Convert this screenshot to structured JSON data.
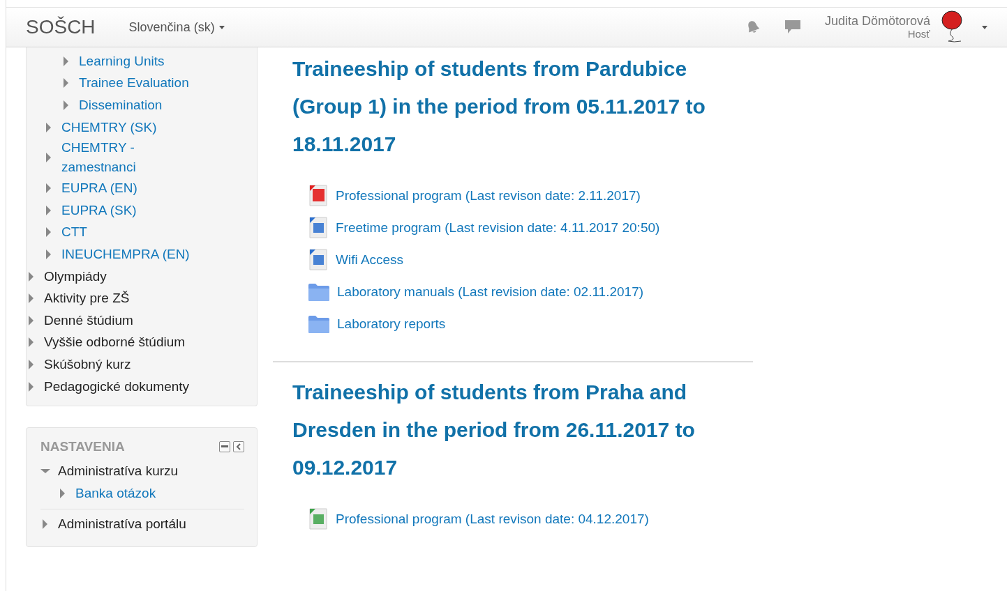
{
  "navbar": {
    "brand": "SOŠCH",
    "language": "Slovenčina (sk)",
    "user_name": "Judita Dömötorová",
    "user_role": "Hosť"
  },
  "navigation": {
    "items": [
      {
        "children": [
          {
            "children": [
              {
                "label": "Learning Units",
                "kind": "link",
                "expanded": false
              },
              {
                "label": "Trainee Evaluation",
                "kind": "link",
                "expanded": false
              },
              {
                "label": "Dissemination",
                "kind": "link",
                "expanded": false
              }
            ]
          },
          {
            "label": "CHEMTRY (SK)",
            "kind": "link",
            "expanded": false
          },
          {
            "label": "CHEMTRY - zamestnanci",
            "kind": "link",
            "expanded": false
          },
          {
            "label": "EUPRA (EN)",
            "kind": "link",
            "expanded": false
          },
          {
            "label": "EUPRA (SK)",
            "kind": "link",
            "expanded": false
          },
          {
            "label": "CTT",
            "kind": "link",
            "expanded": false
          },
          {
            "label": "INEUCHEMPRA (EN)",
            "kind": "link",
            "expanded": false
          }
        ]
      },
      {
        "label": "Olympiády",
        "kind": "category",
        "expanded": false
      },
      {
        "label": "Aktivity pre ZŠ",
        "kind": "category",
        "expanded": false
      },
      {
        "label": "Denné štúdium",
        "kind": "category",
        "expanded": false
      },
      {
        "label": "Vyššie odborné štúdium",
        "kind": "category",
        "expanded": false
      },
      {
        "label": "Skúšobný kurz",
        "kind": "category",
        "expanded": false
      },
      {
        "label": "Pedagogické dokumenty",
        "kind": "category",
        "expanded": false
      }
    ]
  },
  "settings": {
    "title": "NASTAVENIA",
    "items": [
      {
        "label": "Administratíva kurzu",
        "kind": "category",
        "expanded": true,
        "children": [
          {
            "label": "Banka otázok",
            "kind": "link",
            "expanded": false
          }
        ]
      },
      {
        "label": "Administratíva portálu",
        "kind": "category",
        "expanded": false
      }
    ]
  },
  "sections": [
    {
      "title": "Traineeship of students from Pardubice (Group 1) in the period from 05.11.2017 to 18.11.2017",
      "files": [
        {
          "kind": "pdf",
          "label": "Professional program (Last revison date: 2.11.2017)"
        },
        {
          "kind": "word",
          "label": "Freetime program (Last revision date: 4.11.2017 20:50)"
        },
        {
          "kind": "word",
          "label": "Wifi Access"
        },
        {
          "kind": "folder",
          "label": "Laboratory manuals (Last revision date: 02.11.2017)"
        },
        {
          "kind": "folder",
          "label": "Laboratory reports"
        }
      ]
    },
    {
      "title": "Traineeship of students from Praha and Dresden in the period from 26.11.2017 to 09.12.2017",
      "files": [
        {
          "kind": "excel",
          "label": "Professional program (Last revison date: 04.12.2017)"
        }
      ]
    }
  ]
}
